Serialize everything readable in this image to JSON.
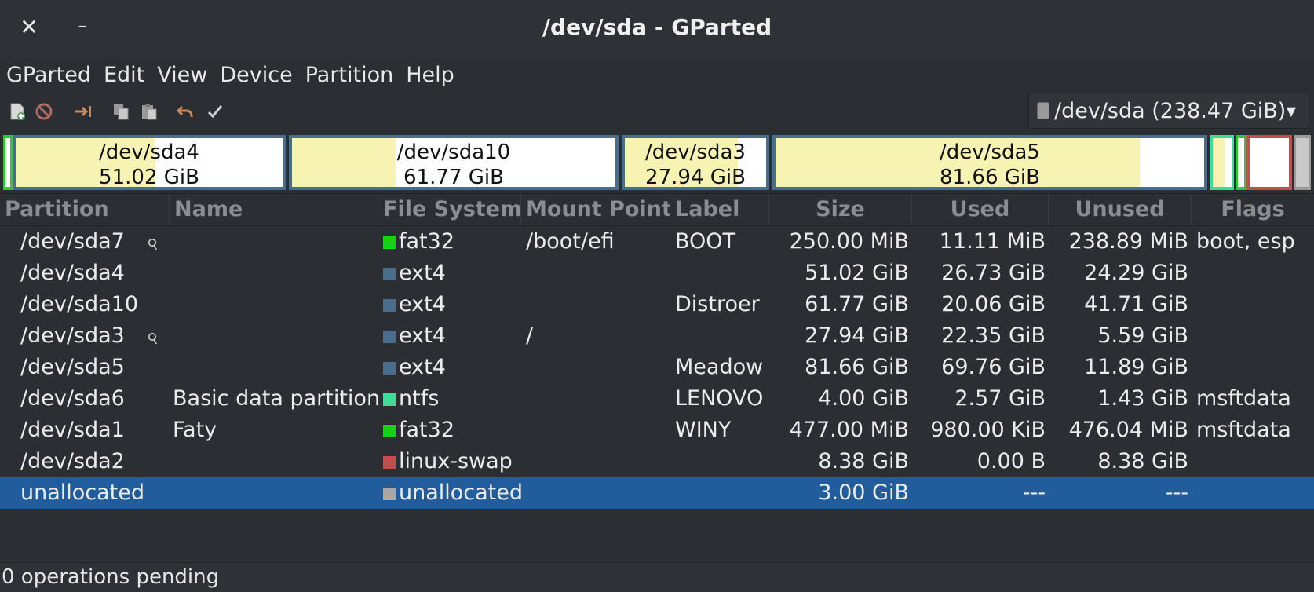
{
  "window": {
    "title": "/dev/sda - GParted"
  },
  "menu": [
    "GParted",
    "Edit",
    "View",
    "Device",
    "Partition",
    "Help"
  ],
  "toolbar": {
    "icons": [
      "new-icon",
      "delete-icon",
      "resize-move-icon",
      "copy-icon",
      "paste-icon",
      "undo-icon",
      "apply-icon"
    ]
  },
  "device": {
    "label": "/dev/sda (238.47 GiB)"
  },
  "disk_map": [
    {
      "name": "/dev/sda7",
      "size": "",
      "border": "#2ecc2e",
      "used": 0.05
    },
    {
      "name": "/dev/sda4",
      "size": "51.02 GiB",
      "border": "#4a6d8c",
      "used": 0.52
    },
    {
      "name": "/dev/sda10",
      "size": "61.77 GiB",
      "border": "#4a6d8c",
      "used": 0.32
    },
    {
      "name": "/dev/sda3",
      "size": "27.94 GiB",
      "border": "#4a6d8c",
      "used": 0.8
    },
    {
      "name": "/dev/sda5",
      "size": "81.66 GiB",
      "border": "#4a6d8c",
      "used": 0.85
    },
    {
      "name": "/dev/sda6",
      "size": "",
      "border": "#3ddc97",
      "used": 0.64
    },
    {
      "name": "/dev/sda1",
      "size": "",
      "border": "#2ecc2e",
      "used": 0.0
    },
    {
      "name": "/dev/sda2",
      "size": "",
      "border": "#c0504d",
      "used": 0.0
    },
    {
      "name": "unallocated",
      "size": "",
      "border": "#9a9a9a",
      "used": 0.0
    }
  ],
  "columns": [
    "Partition",
    "Name",
    "File System",
    "Mount Point",
    "Label",
    "Size",
    "Used",
    "Unused",
    "Flags"
  ],
  "rows": [
    {
      "partition": "/dev/sda7",
      "key": true,
      "name": "",
      "fs": "fat32",
      "fs_color": "#19d019",
      "mount": "/boot/efi",
      "label": "BOOT",
      "size": "250.00 MiB",
      "used": "11.11 MiB",
      "unused": "238.89 MiB",
      "flags": "boot, esp"
    },
    {
      "partition": "/dev/sda4",
      "key": false,
      "name": "",
      "fs": "ext4",
      "fs_color": "#4a6d8c",
      "mount": "",
      "label": "",
      "size": "51.02 GiB",
      "used": "26.73 GiB",
      "unused": "24.29 GiB",
      "flags": ""
    },
    {
      "partition": "/dev/sda10",
      "key": false,
      "name": "",
      "fs": "ext4",
      "fs_color": "#4a6d8c",
      "mount": "",
      "label": "Distroer",
      "size": "61.77 GiB",
      "used": "20.06 GiB",
      "unused": "41.71 GiB",
      "flags": ""
    },
    {
      "partition": "/dev/sda3",
      "key": true,
      "name": "",
      "fs": "ext4",
      "fs_color": "#4a6d8c",
      "mount": "/",
      "label": "",
      "size": "27.94 GiB",
      "used": "22.35 GiB",
      "unused": "5.59 GiB",
      "flags": ""
    },
    {
      "partition": "/dev/sda5",
      "key": false,
      "name": "",
      "fs": "ext4",
      "fs_color": "#4a6d8c",
      "mount": "",
      "label": "Meadow",
      "size": "81.66 GiB",
      "used": "69.76 GiB",
      "unused": "11.89 GiB",
      "flags": ""
    },
    {
      "partition": "/dev/sda6",
      "key": false,
      "name": "Basic data partition",
      "fs": "ntfs",
      "fs_color": "#3ddc97",
      "mount": "",
      "label": "LENOVO",
      "size": "4.00 GiB",
      "used": "2.57 GiB",
      "unused": "1.43 GiB",
      "flags": "msftdata"
    },
    {
      "partition": "/dev/sda1",
      "key": false,
      "name": "Faty",
      "fs": "fat32",
      "fs_color": "#19d019",
      "mount": "",
      "label": "WINY",
      "size": "477.00 MiB",
      "used": "980.00 KiB",
      "unused": "476.04 MiB",
      "flags": "msftdata"
    },
    {
      "partition": "/dev/sda2",
      "key": false,
      "name": "",
      "fs": "linux-swap",
      "fs_color": "#c0504d",
      "mount": "",
      "label": "",
      "size": "8.38 GiB",
      "used": "0.00 B",
      "unused": "8.38 GiB",
      "flags": ""
    },
    {
      "partition": "unallocated",
      "key": false,
      "name": "",
      "fs": "unallocated",
      "fs_color": "#a8a8a8",
      "mount": "",
      "label": "",
      "size": "3.00 GiB",
      "used": "---",
      "unused": "---",
      "flags": "",
      "selected": true
    }
  ],
  "status": {
    "text": "0 operations pending"
  }
}
